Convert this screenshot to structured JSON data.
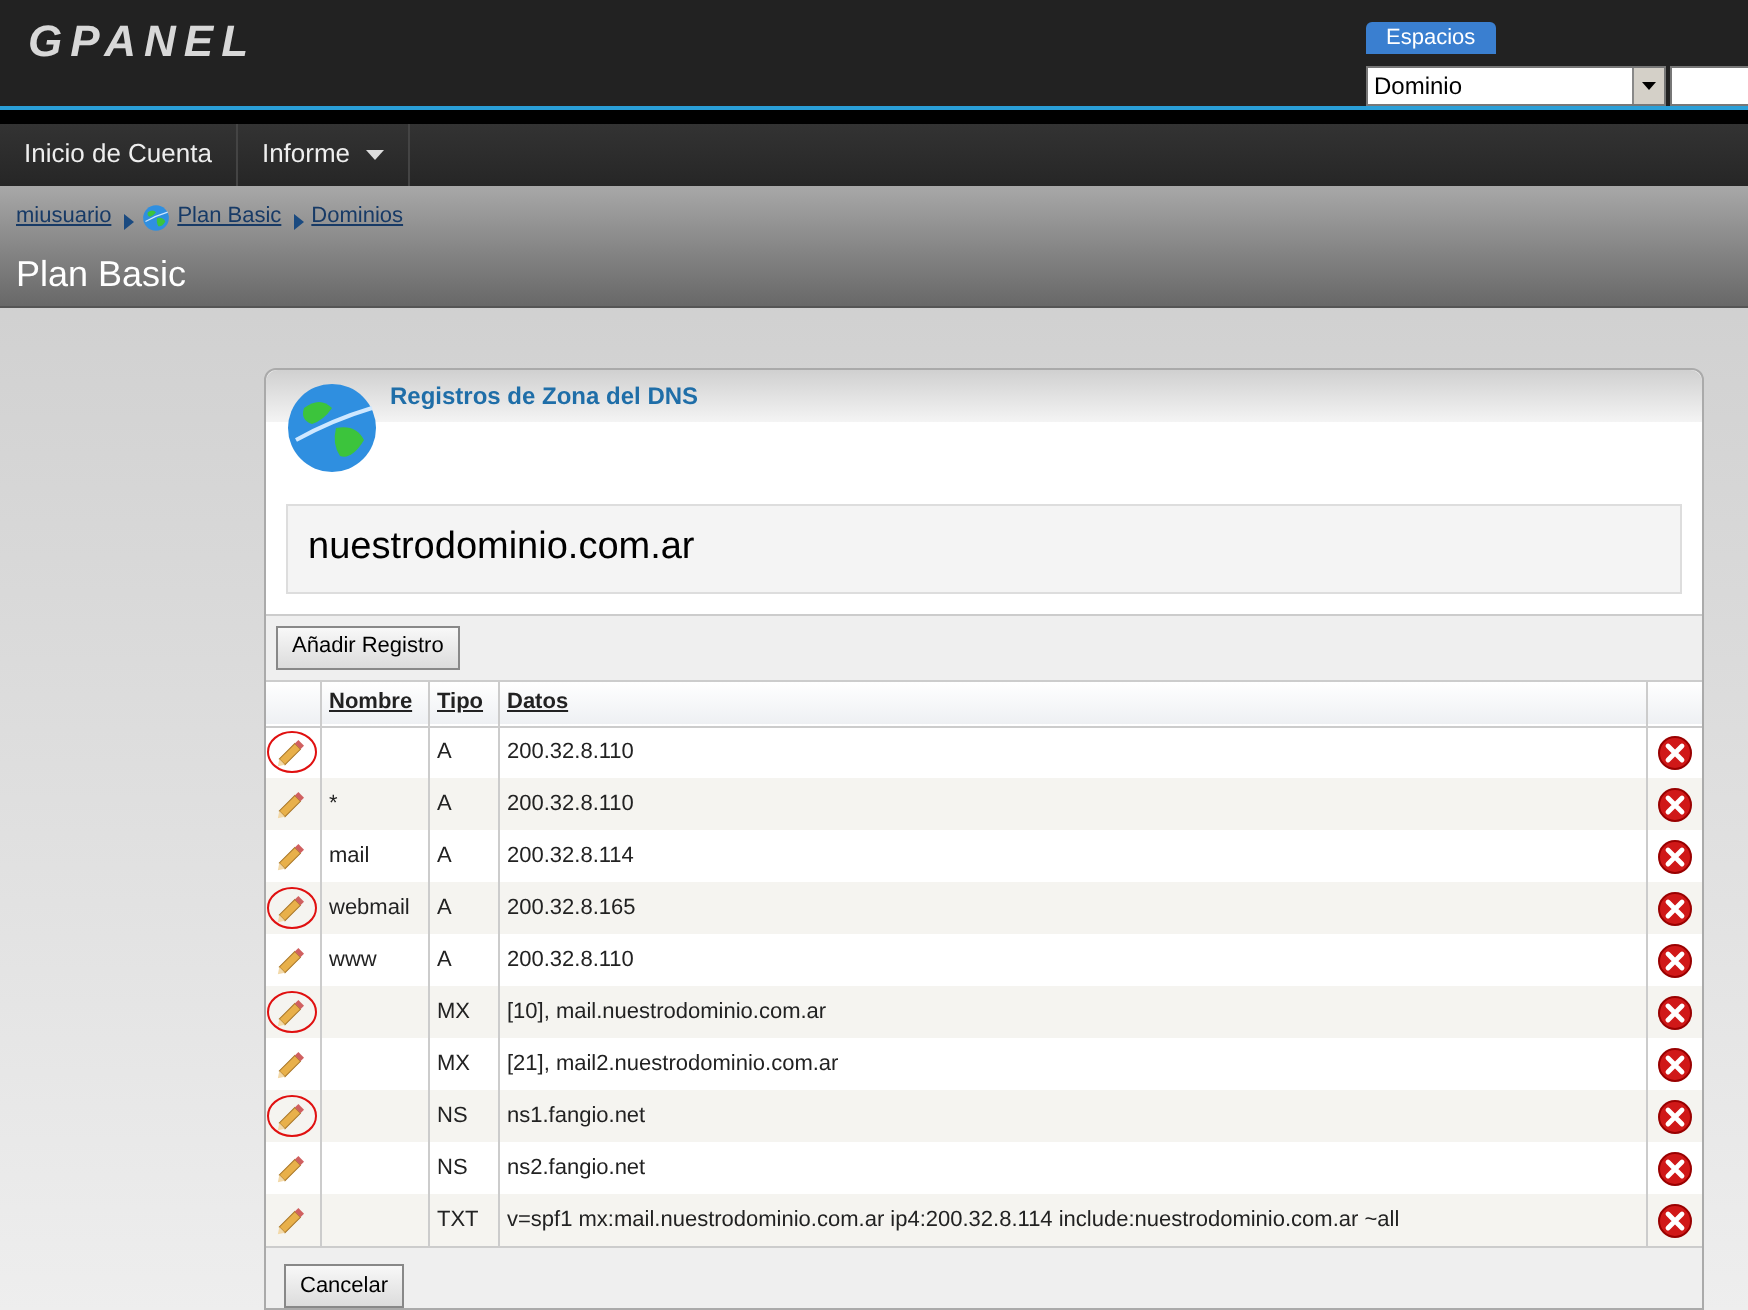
{
  "logo": "GPANEL",
  "spaces": {
    "button": "Espacios",
    "select_value": "Dominio"
  },
  "nav": [
    {
      "label": "Inicio de Cuenta",
      "dropdown": false
    },
    {
      "label": "Informe",
      "dropdown": true
    }
  ],
  "breadcrumb": [
    {
      "label": "miusuario",
      "globe": false
    },
    {
      "label": "Plan Basic",
      "globe": true
    },
    {
      "label": "Dominios",
      "globe": false
    }
  ],
  "page_title": "Plan Basic",
  "panel": {
    "title": "Registros de Zona del DNS",
    "domain": "nuestrodominio.com.ar",
    "add_button": "Añadir Registro",
    "columns": [
      "Nombre",
      "Tipo",
      "Datos"
    ],
    "rows": [
      {
        "name": "",
        "type": "A",
        "data": "200.32.8.110",
        "circled": true
      },
      {
        "name": "*",
        "type": "A",
        "data": "200.32.8.110",
        "circled": false
      },
      {
        "name": "mail",
        "type": "A",
        "data": "200.32.8.114",
        "circled": false
      },
      {
        "name": "webmail",
        "type": "A",
        "data": "200.32.8.165",
        "circled": true
      },
      {
        "name": "www",
        "type": "A",
        "data": "200.32.8.110",
        "circled": false
      },
      {
        "name": "",
        "type": "MX",
        "data": "[10], mail.nuestrodominio.com.ar",
        "circled": true
      },
      {
        "name": "",
        "type": "MX",
        "data": "[21], mail2.nuestrodominio.com.ar",
        "circled": false
      },
      {
        "name": "",
        "type": "NS",
        "data": "ns1.fangio.net",
        "circled": true
      },
      {
        "name": "",
        "type": "NS",
        "data": "ns2.fangio.net",
        "circled": false
      },
      {
        "name": "",
        "type": "TXT",
        "data": "v=spf1 mx:mail.nuestrodominio.com.ar ip4:200.32.8.114 include:nuestrodominio.com.ar ~all",
        "circled": false
      }
    ],
    "cancel_button": "Cancelar"
  }
}
